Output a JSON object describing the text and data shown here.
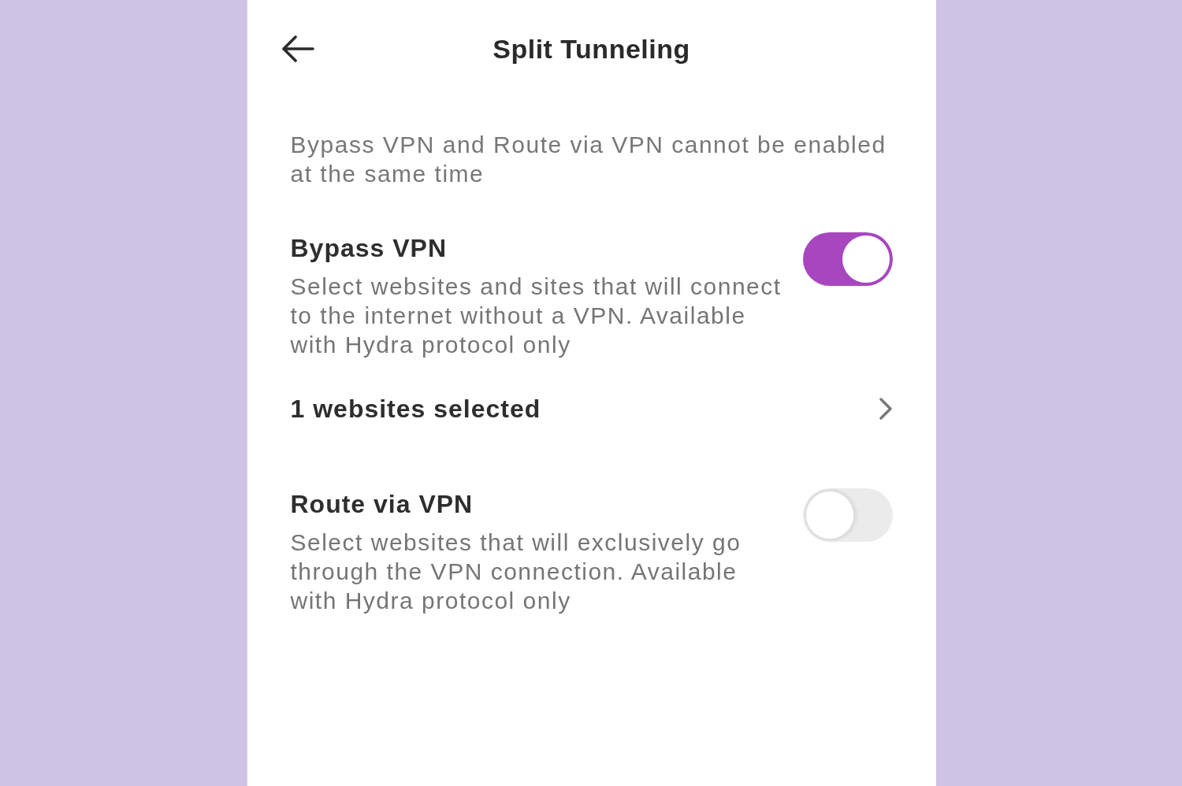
{
  "header": {
    "title": "Split Tunneling"
  },
  "notice": "Bypass VPN and Route via VPN cannot be enabled at the same time",
  "sections": [
    {
      "title": "Bypass VPN",
      "description": "Select websites and sites that will connect to the internet without a VPN. Available with Hydra protocol only",
      "on": true,
      "link": {
        "label": "1 websites selected"
      }
    },
    {
      "title": "Route via VPN",
      "description": "Select websites that will exclusively go through the VPN connection. Available with Hydra protocol only",
      "on": false
    }
  ]
}
